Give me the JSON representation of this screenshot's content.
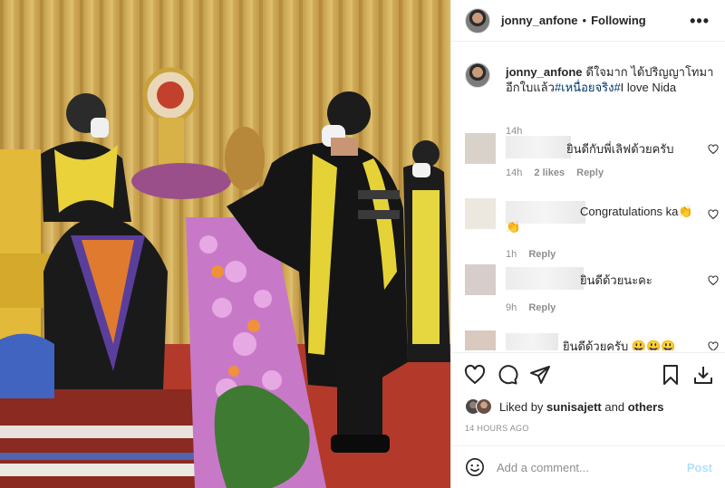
{
  "header": {
    "username": "jonny_anfone",
    "separator": "•",
    "follow_label": "Following",
    "more_label": "•••"
  },
  "caption": {
    "username": "jonny_anfone",
    "text": "ดีใจมาก ได้ปริญญาโทมาอีกใบแล้ว",
    "hashtags": "#เหนื่อยจริง#",
    "tail": "I love Nida",
    "time": "14h"
  },
  "comments": [
    {
      "text": "ยินดีกับพี่เลิฟด้วยครับ",
      "time": "14h",
      "likes": "2 likes",
      "reply": "Reply"
    },
    {
      "text": "Congratulations ka👏",
      "text2": "👏",
      "time": "1h",
      "reply": "Reply"
    },
    {
      "text": "ยินดีด้วยนะคะ",
      "time": "9h",
      "reply": "Reply"
    },
    {
      "text": "ยินดีด้วยครับ 😃😃😃"
    }
  ],
  "likes": {
    "prefix": "Liked by",
    "user": "sunisajett",
    "middle": "and",
    "others": "others"
  },
  "timestamp": "14 HOURS AGO",
  "add_comment": {
    "placeholder": "Add a comment...",
    "post_label": "Post"
  },
  "colors": {
    "link": "#00376b",
    "muted": "#8e8e8e",
    "post_disabled": "#b2dffc"
  }
}
